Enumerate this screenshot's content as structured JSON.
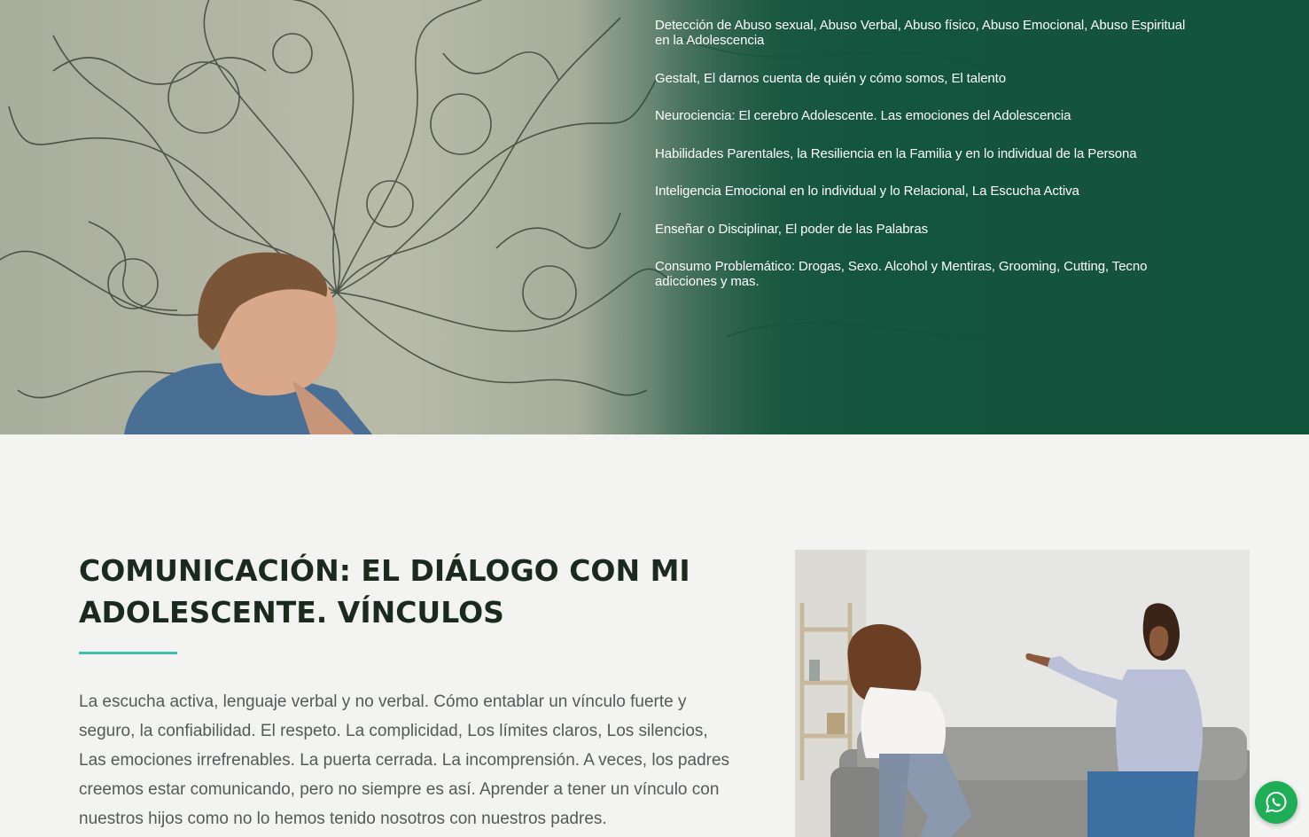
{
  "hero": {
    "topics": [
      "Detección de Abuso sexual, Abuso Verbal, Abuso físico, Abuso Emocional, Abuso Espiritual en la Adolescencia",
      "Gestalt, El darnos cuenta de quién y cómo somos, El talento",
      "Neurociencia: El cerebro Adolescente. Las emociones del Adolescencia",
      "Habilidades Parentales, la Resiliencia en la Familia y en lo individual de la Persona",
      "Inteligencia Emocional en lo individual y lo Relacional, La Escucha Activa",
      "Enseñar o Disciplinar, El poder de las Palabras",
      "Consumo Problemático: Drogas, Sexo. Alcohol y Mentiras, Grooming, Cutting, Tecno adicciones y mas."
    ],
    "overlay_color": "#13553f"
  },
  "section": {
    "title": "COMUNICACIÓN: EL DIÁLOGO CON MI ADOLESCENTE. VÍNCULOS",
    "body": "La escucha activa, lenguaje verbal y no verbal. Cómo entablar un vínculo fuerte y seguro, la confiabilidad. El respeto. La complicidad, Los límites claros, Los silencios, Las emociones irrefrenables. La puerta cerrada. La incomprensión. A veces, los padres creemos estar comunicando, pero no siempre es así. Aprender a tener un vínculo con nuestros hijos como no lo hemos tenido nosotros con nuestros padres.",
    "accent_color": "#3fbfae"
  },
  "floating": {
    "whatsapp_icon": "whatsapp-icon",
    "whatsapp_color": "#1fae56"
  }
}
